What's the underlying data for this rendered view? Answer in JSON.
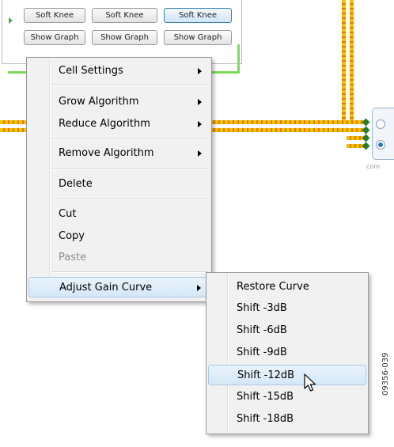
{
  "background": {
    "buttons_row1": [
      "Soft Knee",
      "Soft Knee",
      "Soft Knee"
    ],
    "buttons_row2": [
      "Show Graph",
      "Show Graph",
      "Show Graph"
    ],
    "block_label": "com",
    "figure_id": "09356-039"
  },
  "context_menu": {
    "items": [
      {
        "label": "Cell Settings",
        "submenu": true
      },
      {
        "label": "Grow Algorithm",
        "submenu": true
      },
      {
        "label": "Reduce Algorithm",
        "submenu": true
      },
      {
        "label": "Remove Algorithm",
        "submenu": true
      },
      {
        "label": "Delete",
        "submenu": false
      },
      {
        "label": "Cut",
        "submenu": false
      },
      {
        "label": "Copy",
        "submenu": false
      },
      {
        "label": "Paste",
        "submenu": false,
        "disabled": true
      },
      {
        "label": "Adjust Gain Curve",
        "submenu": true,
        "highlighted": true
      }
    ]
  },
  "submenu": {
    "items": [
      {
        "label": "Restore Curve"
      },
      {
        "label": "Shift -3dB"
      },
      {
        "label": "Shift -6dB"
      },
      {
        "label": "Shift -9dB"
      },
      {
        "label": "Shift -12dB",
        "highlighted": true
      },
      {
        "label": "Shift -15dB"
      },
      {
        "label": "Shift -18dB"
      }
    ]
  },
  "colors": {
    "menu_bg": "#f1f1f1",
    "highlight": "#d4e7f8",
    "wire": "#f2c200",
    "connector": "#7ed957"
  }
}
